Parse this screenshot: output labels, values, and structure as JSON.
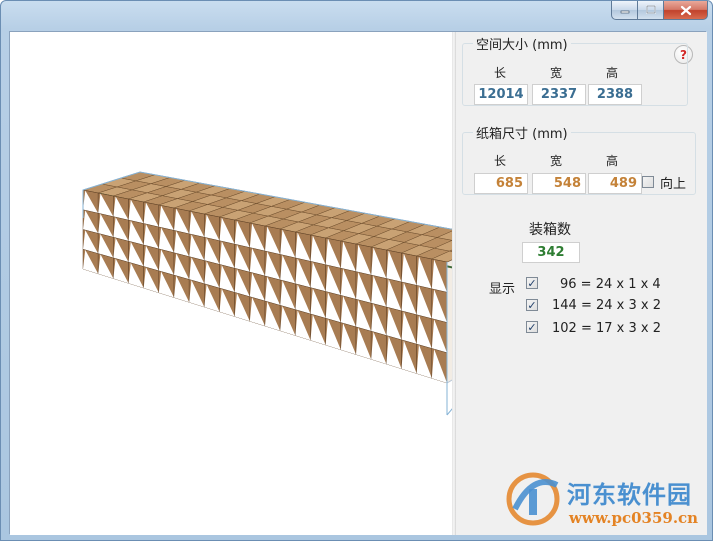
{
  "window": {
    "controls": {
      "minimize_icon": "minimize-icon",
      "maximize_icon": "maximize-icon",
      "close_icon": "close-icon"
    }
  },
  "space": {
    "title": "空间大小 (mm)",
    "length_label": "长",
    "width_label": "宽",
    "height_label": "高",
    "length": "12014",
    "width": "2337",
    "height": "2388"
  },
  "carton": {
    "title": "纸箱尺寸 (mm)",
    "length_label": "长",
    "width_label": "宽",
    "height_label": "高",
    "length": "685",
    "width": "548",
    "height": "489",
    "upright_label": "向上",
    "upright_checked": false
  },
  "count": {
    "label": "装箱数",
    "value": "342"
  },
  "display": {
    "label": "显示",
    "rows": [
      {
        "text": "96 = 24 x 1 x 4",
        "checked": true
      },
      {
        "text": "144 = 24 x 3 x 2",
        "checked": true
      },
      {
        "text": "102 = 17 x 3 x 2",
        "checked": true
      }
    ]
  },
  "help_icon": "help-icon",
  "colors": {
    "box_front": "#a87c52",
    "box_top": "#c9a274",
    "box_side": "#8f643d",
    "triangle": "#ffffff",
    "value_blue": "#3b6e92",
    "value_orange": "#c48238",
    "value_green": "#2e7d32"
  },
  "watermark": {
    "title": "河东软件园",
    "url": "www.pc0359.cn"
  }
}
